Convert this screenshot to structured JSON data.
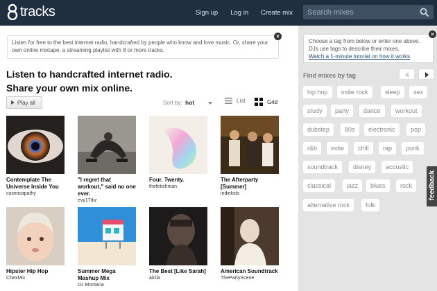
{
  "header": {
    "logo_text": "tracks",
    "nav": [
      "Sign up",
      "Log in",
      "Create mix"
    ],
    "search_placeholder": "Search mixes"
  },
  "intro": {
    "text": "Listen for free to the best internet radio, handcrafted by people who know and love music. Or, share your own online mixtape, a streaming playlist with 8 or more tracks."
  },
  "headline": {
    "line1": "Listen to handcrafted internet radio.",
    "line2": "Share your own mix online."
  },
  "toolbar": {
    "play_all": "Play all",
    "sort_label": "Sort by:",
    "sort_value": "hot",
    "list_label": "List",
    "grid_label": "Grid"
  },
  "mixes": [
    {
      "title": "Contemplate The Universe Inside You",
      "user": "cosmicapathy"
    },
    {
      "title": "\"I regret that workout,\" said no one ever.",
      "user": "evy17diz"
    },
    {
      "title": "Four. Twenty.",
      "user": "thefetishman"
    },
    {
      "title": "The Afterparty [Summer]",
      "user": "indiekids"
    },
    {
      "title": "Hipster Hip Hop",
      "user": "ChexMix"
    },
    {
      "title": "Summer Mega Mashup Mix",
      "user": "DJ Montana"
    },
    {
      "title": "The Best [Like Sarah]",
      "user": "alcila"
    },
    {
      "title": "American Soundtrack",
      "user": "ThePartyScene"
    }
  ],
  "sidebar": {
    "tip": "Choose a tag from below or enter one above. DJs use tags to describe their mixes.",
    "tutorial_link": "Watch a 1-minute tutorial on how it works",
    "find_label": "Find mixes by tag",
    "tags": [
      "hip hop",
      "indie rock",
      "sleep",
      "sex",
      "study",
      "party",
      "dance",
      "workout",
      "dubstep",
      "80s",
      "electronic",
      "pop",
      "r&b",
      "indie",
      "chill",
      "rap",
      "punk",
      "soundtrack",
      "disney",
      "acoustic",
      "classical",
      "jazz",
      "blues",
      "rock",
      "alternative rock",
      "folk"
    ]
  },
  "feedback_label": "feedback",
  "colors": {
    "topbar": "#1f2f3f",
    "search_bg": "#3e5163",
    "sidebar_bg": "#e4e4e4",
    "link": "#1e4b7a"
  }
}
